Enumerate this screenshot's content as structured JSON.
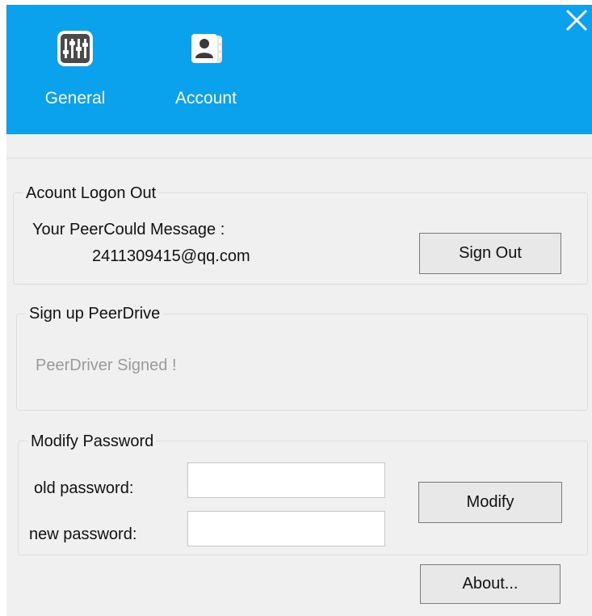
{
  "header": {
    "tabs": [
      {
        "label": "General",
        "icon": "sliders-icon"
      },
      {
        "label": "Account",
        "icon": "contact-book-icon"
      }
    ],
    "close_icon": "close-icon",
    "accent": "#0aa2ec"
  },
  "account_logon": {
    "title": "Acount Logon Out",
    "message_label": "Your PeerCould Message :",
    "email": "2411309415@qq.com",
    "sign_out_label": "Sign Out"
  },
  "signup": {
    "title": "Sign up PeerDrive",
    "status": "PeerDriver Signed !"
  },
  "modify_password": {
    "title": "Modify Password",
    "old_label": "old password:",
    "new_label": "new password:",
    "old_value": "",
    "new_value": "",
    "modify_label": "Modify"
  },
  "footer": {
    "about_label": "About..."
  }
}
